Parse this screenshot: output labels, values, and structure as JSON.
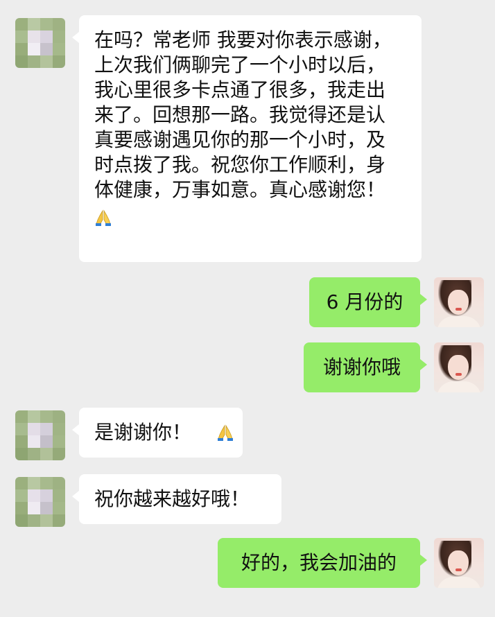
{
  "chat": {
    "messages": [
      {
        "side": "left",
        "lines": [
          "在吗？常老师  我要对你表示感谢，",
          "上次我们俩聊完了一个小时以后，",
          "我心里很多卡点通了很多，我走出",
          "来了。回想那一路。我觉得还是认",
          "真要感谢遇见你的那一个小时，及",
          "时点拨了我。祝您你工作顺利，身",
          "体健康，万事如意。真心感谢您！"
        ],
        "emoji": "folded-hands"
      },
      {
        "side": "right",
        "text": "6 月份的"
      },
      {
        "side": "right",
        "text": "谢谢你哦"
      },
      {
        "side": "left",
        "text": "是谢谢你！",
        "emoji": "folded-hands"
      },
      {
        "side": "left",
        "text": "祝你越来越好哦！"
      },
      {
        "side": "right",
        "text": "好的，我会加油的"
      }
    ]
  },
  "colors": {
    "background": "#ededed",
    "left_bubble": "#ffffff",
    "right_bubble": "#95ec69"
  }
}
